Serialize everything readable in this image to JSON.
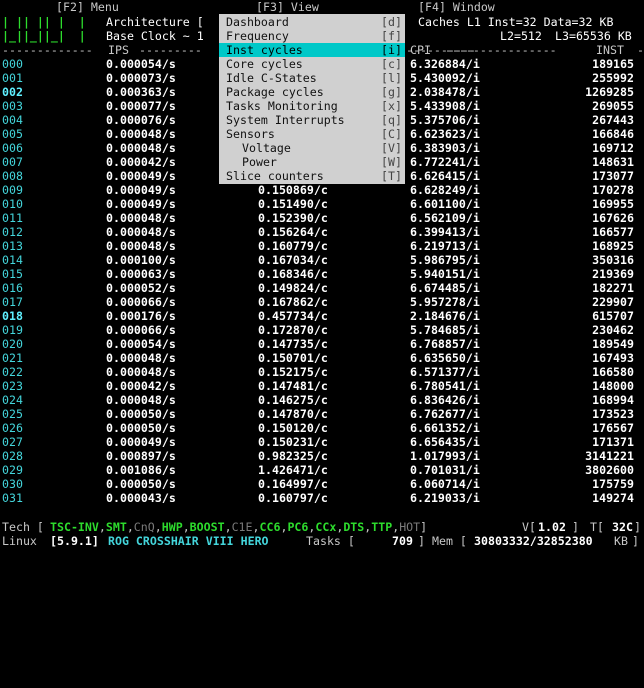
{
  "title_bar": {
    "menu": "[F2] Menu",
    "view": "[F3] View",
    "window": "[F4] Window"
  },
  "header": {
    "arch_label": "Architecture [",
    "caches": "Caches L1 Inst=32 Data=32 KB",
    "base_clock_label": "Base Clock ~ 1",
    "cache_l2": "L2=512",
    "cache_l3": "L3=65536 KB",
    "col_ips": "IPS",
    "col_cpi": "CPI",
    "col_inst": "INST"
  },
  "view_menu": [
    {
      "label": "Dashboard",
      "key": "[d]"
    },
    {
      "label": "Frequency",
      "key": "[f]"
    },
    {
      "label": "Inst cycles",
      "key": "[i]",
      "selected": true
    },
    {
      "label": "Core cycles",
      "key": "[c]"
    },
    {
      "label": "Idle C-States",
      "key": "[l]"
    },
    {
      "label": "Package cycles",
      "key": "[g]"
    },
    {
      "label": "Tasks Monitoring",
      "key": "[x]"
    },
    {
      "label": "System Interrupts",
      "key": "[q]"
    },
    {
      "label": "Sensors",
      "key": "[C]"
    },
    {
      "label": "Voltage",
      "key": "[V]",
      "sub": true
    },
    {
      "label": "Power",
      "key": "[W]",
      "sub": true
    },
    {
      "label": "Slice counters",
      "key": "[T]"
    }
  ],
  "rows": [
    {
      "cpu": "000",
      "ips": "0.000054/s",
      "ipc": "",
      "cpi": "6.326884/i",
      "inst": "189165"
    },
    {
      "cpu": "001",
      "ips": "0.000073/s",
      "ipc": "",
      "cpi": "5.430092/i",
      "inst": "255992"
    },
    {
      "cpu": "002",
      "ips": "0.000363/s",
      "ipc": "",
      "cpi": "2.038478/i",
      "inst": "1269285",
      "hl": true
    },
    {
      "cpu": "003",
      "ips": "0.000077/s",
      "ipc": "",
      "cpi": "5.433908/i",
      "inst": "269055"
    },
    {
      "cpu": "004",
      "ips": "0.000076/s",
      "ipc": "",
      "cpi": "5.375706/i",
      "inst": "267443"
    },
    {
      "cpu": "005",
      "ips": "0.000048/s",
      "ipc": "",
      "cpi": "6.623623/i",
      "inst": "166846"
    },
    {
      "cpu": "006",
      "ips": "0.000048/s",
      "ipc": "",
      "cpi": "6.383903/i",
      "inst": "169712"
    },
    {
      "cpu": "007",
      "ips": "0.000042/s",
      "ipc": "",
      "cpi": "6.772241/i",
      "inst": "148631"
    },
    {
      "cpu": "008",
      "ips": "0.000049/s",
      "ipc": "",
      "cpi": "6.626415/i",
      "inst": "173077"
    },
    {
      "cpu": "009",
      "ips": "0.000049/s",
      "ipc": "0.150869/c",
      "cpi": "6.628249/i",
      "inst": "170278"
    },
    {
      "cpu": "010",
      "ips": "0.000049/s",
      "ipc": "0.151490/c",
      "cpi": "6.601100/i",
      "inst": "169955"
    },
    {
      "cpu": "011",
      "ips": "0.000048/s",
      "ipc": "0.152390/c",
      "cpi": "6.562109/i",
      "inst": "167626"
    },
    {
      "cpu": "012",
      "ips": "0.000048/s",
      "ipc": "0.156264/c",
      "cpi": "6.399413/i",
      "inst": "166577"
    },
    {
      "cpu": "013",
      "ips": "0.000048/s",
      "ipc": "0.160779/c",
      "cpi": "6.219713/i",
      "inst": "168925"
    },
    {
      "cpu": "014",
      "ips": "0.000100/s",
      "ipc": "0.167034/c",
      "cpi": "5.986795/i",
      "inst": "350316"
    },
    {
      "cpu": "015",
      "ips": "0.000063/s",
      "ipc": "0.168346/c",
      "cpi": "5.940151/i",
      "inst": "219369"
    },
    {
      "cpu": "016",
      "ips": "0.000052/s",
      "ipc": "0.149824/c",
      "cpi": "6.674485/i",
      "inst": "182271"
    },
    {
      "cpu": "017",
      "ips": "0.000066/s",
      "ipc": "0.167862/c",
      "cpi": "5.957278/i",
      "inst": "229907"
    },
    {
      "cpu": "018",
      "ips": "0.000176/s",
      "ipc": "0.457734/c",
      "cpi": "2.184676/i",
      "inst": "615707",
      "hl": true
    },
    {
      "cpu": "019",
      "ips": "0.000066/s",
      "ipc": "0.172870/c",
      "cpi": "5.784685/i",
      "inst": "230462"
    },
    {
      "cpu": "020",
      "ips": "0.000054/s",
      "ipc": "0.147735/c",
      "cpi": "6.768857/i",
      "inst": "189549"
    },
    {
      "cpu": "021",
      "ips": "0.000048/s",
      "ipc": "0.150701/c",
      "cpi": "6.635650/i",
      "inst": "167493"
    },
    {
      "cpu": "022",
      "ips": "0.000048/s",
      "ipc": "0.152175/c",
      "cpi": "6.571377/i",
      "inst": "166580"
    },
    {
      "cpu": "023",
      "ips": "0.000042/s",
      "ipc": "0.147481/c",
      "cpi": "6.780541/i",
      "inst": "148000"
    },
    {
      "cpu": "024",
      "ips": "0.000048/s",
      "ipc": "0.146275/c",
      "cpi": "6.836426/i",
      "inst": "168994"
    },
    {
      "cpu": "025",
      "ips": "0.000050/s",
      "ipc": "0.147870/c",
      "cpi": "6.762677/i",
      "inst": "173523"
    },
    {
      "cpu": "026",
      "ips": "0.000050/s",
      "ipc": "0.150120/c",
      "cpi": "6.661352/i",
      "inst": "176567"
    },
    {
      "cpu": "027",
      "ips": "0.000049/s",
      "ipc": "0.150231/c",
      "cpi": "6.656435/i",
      "inst": "171371"
    },
    {
      "cpu": "028",
      "ips": "0.000897/s",
      "ipc": "0.982325/c",
      "cpi": "1.017993/i",
      "inst": "3141221"
    },
    {
      "cpu": "029",
      "ips": "0.001086/s",
      "ipc": "1.426471/c",
      "cpi": "0.701031/i",
      "inst": "3802600"
    },
    {
      "cpu": "030",
      "ips": "0.000050/s",
      "ipc": "0.164997/c",
      "cpi": "6.060714/i",
      "inst": "175759"
    },
    {
      "cpu": "031",
      "ips": "0.000043/s",
      "ipc": "0.160797/c",
      "cpi": "6.219033/i",
      "inst": "149274"
    }
  ],
  "status": {
    "tech_label": "Tech [",
    "tech_items": [
      {
        "t": "TSC-INV",
        "on": true
      },
      {
        "t": ",",
        "sep": true
      },
      {
        "t": "SMT",
        "on": true
      },
      {
        "t": ",",
        "sep": true
      },
      {
        "t": "CnQ",
        "on": false
      },
      {
        "t": ",",
        "sep": true
      },
      {
        "t": "HWP",
        "on": true
      },
      {
        "t": ",",
        "sep": true
      },
      {
        "t": "BOOST",
        "on": true
      },
      {
        "t": ",",
        "sep": true
      },
      {
        "t": "C1E",
        "on": false
      },
      {
        "t": ",",
        "sep": true
      },
      {
        "t": "CC6",
        "on": true
      },
      {
        "t": ",",
        "sep": true
      },
      {
        "t": "PC6",
        "on": true
      },
      {
        "t": ",",
        "sep": true
      },
      {
        "t": "CCx",
        "on": true
      },
      {
        "t": ",",
        "sep": true
      },
      {
        "t": "DTS",
        "on": true
      },
      {
        "t": ",",
        "sep": true
      },
      {
        "t": "TTP",
        "on": true
      },
      {
        "t": ",",
        "sep": true
      },
      {
        "t": "HOT",
        "on": false
      },
      {
        "t": "]",
        "sep": true
      }
    ],
    "vcore_label": "V[",
    "vcore_value": "1.02",
    "vcore_close": "]",
    "temp_label": "T[",
    "temp_value": "32C",
    "temp_close": "]",
    "os": "Linux",
    "kernel": "[5.9.1]",
    "board": "ROG CROSSHAIR VIII HERO",
    "tasks_label": "Tasks [",
    "tasks_value": "709",
    "tasks_close": "]",
    "mem_label": "Mem [",
    "mem_value": "30803332/32852380",
    "mem_unit": "KB",
    "mem_close": "]"
  }
}
